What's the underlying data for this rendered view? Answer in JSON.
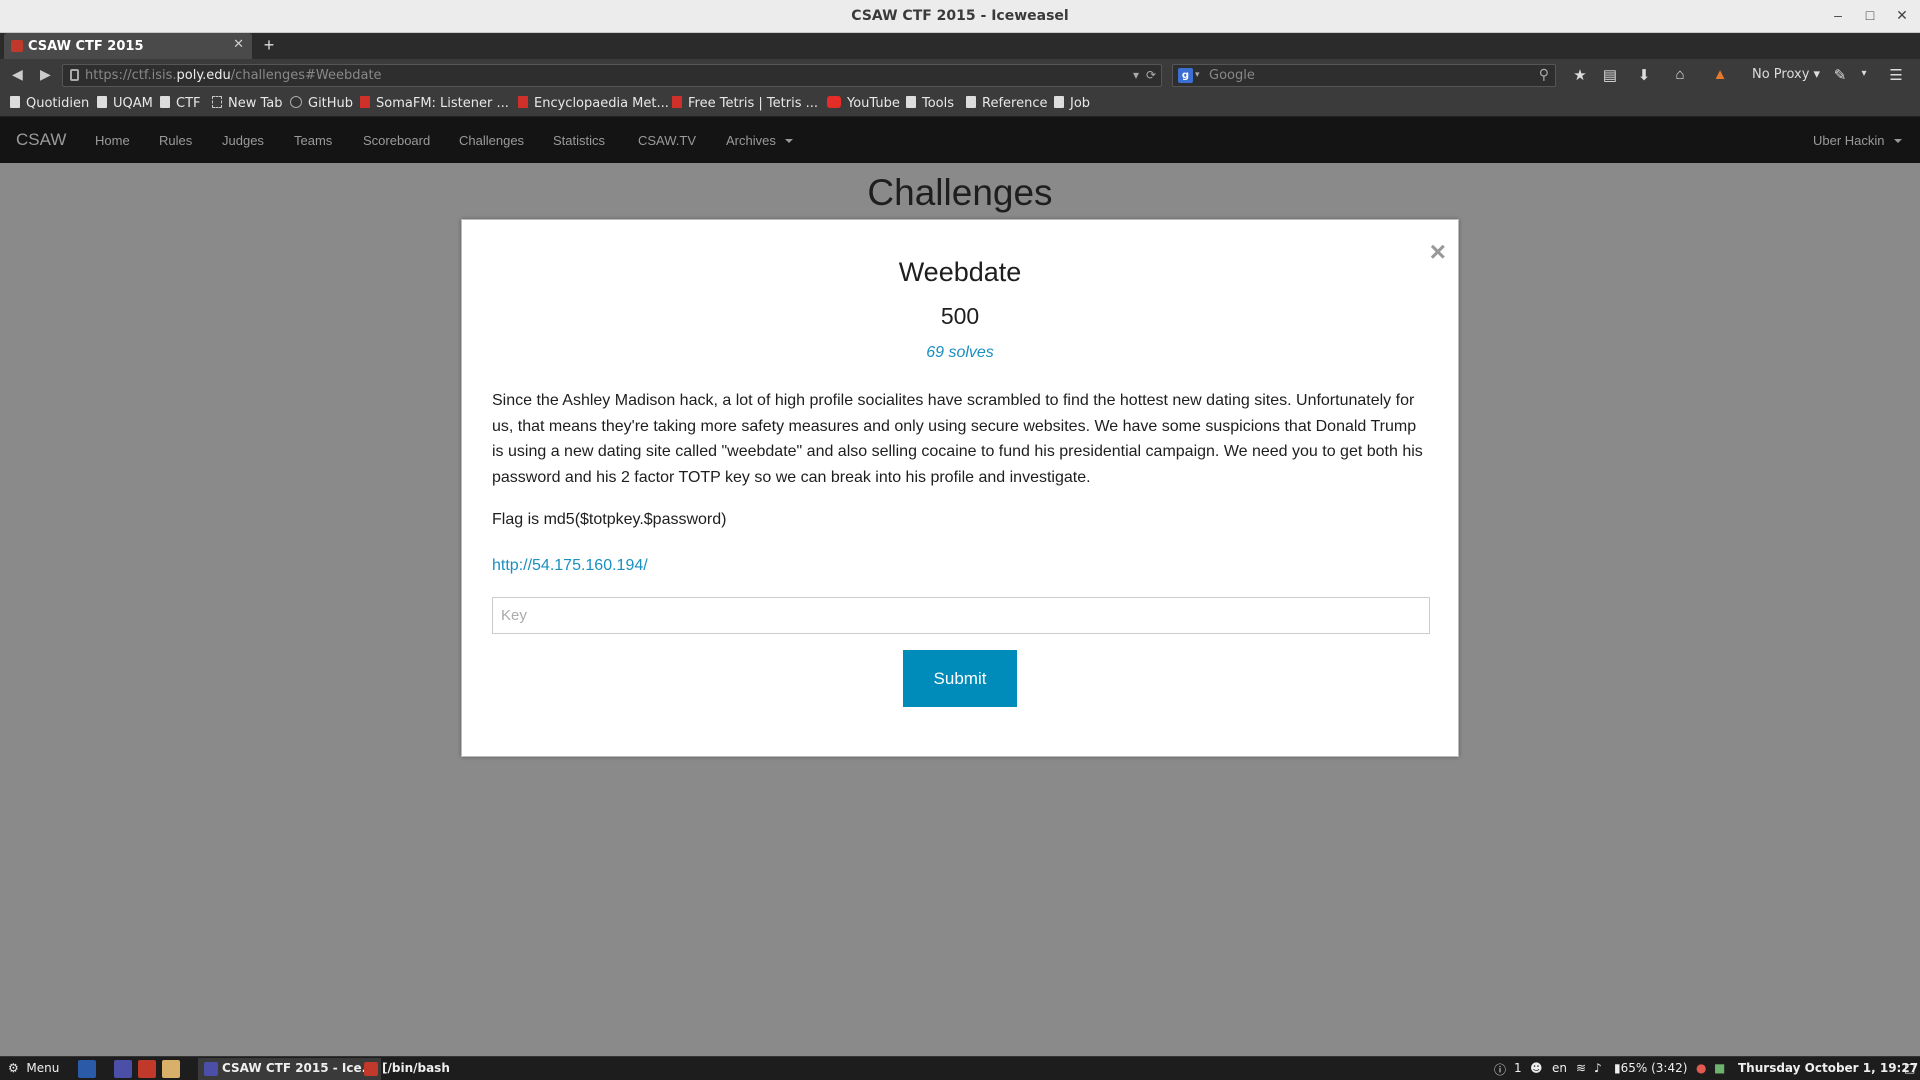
{
  "window": {
    "title": "CSAW CTF 2015 - Iceweasel",
    "minimize_glyph": "–",
    "maximize_glyph": "□",
    "close_glyph": "✕"
  },
  "browser": {
    "tab_title": "CSAW CTF 2015",
    "tab_close_glyph": "✕",
    "new_tab_glyph": "+",
    "url_prefix": "https://ctf.isis.",
    "url_domain": "poly.edu",
    "url_path": "/challenges#Weebdate",
    "search_placeholder": "Google",
    "search_engine_letter": "g",
    "proxy_label": "No Proxy ▾",
    "icons": [
      "back-icon",
      "forward-icon",
      "lock-icon",
      "dropdown-icon",
      "reload-icon",
      "search-icon",
      "star-icon",
      "clipboard-icon",
      "download-icon",
      "home-icon",
      "flame-icon",
      "pen-icon",
      "menu-icon"
    ]
  },
  "bookmarks": [
    {
      "label": "Quotidien",
      "icon": "folder"
    },
    {
      "label": "UQAM",
      "icon": "folder"
    },
    {
      "label": "CTF",
      "icon": "folder"
    },
    {
      "label": "New Tab",
      "icon": "page"
    },
    {
      "label": "GitHub",
      "icon": "github"
    },
    {
      "label": "SomaFM: Listener ...",
      "icon": "somafm"
    },
    {
      "label": "Encyclopaedia Met...",
      "icon": "red"
    },
    {
      "label": "Free Tetris | Tetris ...",
      "icon": "tetris"
    },
    {
      "label": "YouTube",
      "icon": "youtube"
    },
    {
      "label": "Tools",
      "icon": "folder"
    },
    {
      "label": "Reference",
      "icon": "folder"
    },
    {
      "label": "Job",
      "icon": "folder"
    }
  ],
  "site_nav": {
    "brand": "CSAW",
    "links": [
      "Home",
      "Rules",
      "Judges",
      "Teams",
      "Scoreboard",
      "Challenges",
      "Statistics",
      "CSAW.TV",
      "Archives"
    ],
    "user": "Uber Hackin"
  },
  "page": {
    "heading": "Challenges"
  },
  "modal": {
    "close_glyph": "×",
    "title": "Weebdate",
    "points": "500",
    "solves": "69 solves",
    "description": "Since the Ashley Madison hack, a lot of high profile socialites have scrambled to find the hottest new dating sites. Unfortunately for us, that means they're taking more safety measures and only using secure websites. We have some suspicions that Donald Trump is using a new dating site called \"weebdate\" and also selling cocaine to fund his presidential campaign. We need you to get both his password and his 2 factor TOTP key so we can break into his profile and investigate.",
    "flag_text": "Flag is md5($totpkey.$password)",
    "link": "http://54.175.160.194/",
    "key_placeholder": "Key",
    "key_value": "",
    "submit_label": "Submit"
  },
  "taskbar": {
    "menu_label": "Menu",
    "windows": [
      {
        "label": "CSAW CTF 2015 - Ice...",
        "active": true
      },
      {
        "label": "[/bin/bash",
        "active": false
      }
    ],
    "tray": {
      "notification_count": "1",
      "language": "en",
      "battery": "65% (3:42)",
      "clock": "Thursday October  1, 19:27"
    }
  }
}
